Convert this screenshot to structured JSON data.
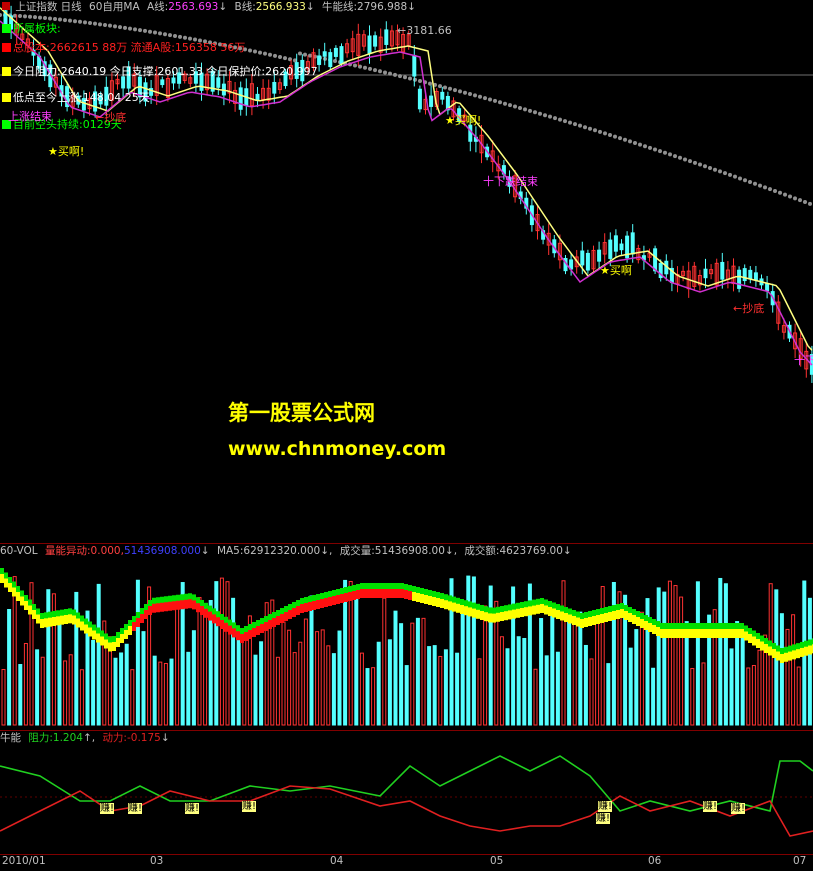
{
  "main": {
    "header": {
      "title": "上证指数 日线",
      "indicator": "60自用MA",
      "a_label": "A线:",
      "a_value": "2563.693",
      "a_arrow": "↓",
      "b_label": "B线:",
      "b_value": "2566.933",
      "b_arrow": "↓",
      "nn_label": "牛能线:",
      "nn_value": "2796.988",
      "nn_arrow": "↓"
    },
    "info_lines": [
      {
        "text": "所属板块:",
        "color": "#00ff00"
      },
      {
        "text": "总股本:2662615 88万  流通A股:156358 56万",
        "color": "#ff0000"
      },
      {
        "text": "今日阻力:2640.19  今日支撑:2601.33  今日保护价:2620.997",
        "color": "#ffffff"
      },
      {
        "text": "低点至今上涨:148.04  25天",
        "color": "#ffffff"
      },
      {
        "text": "目前空头持续:0129天",
        "color": "#00ff00"
      }
    ],
    "annotations": [
      {
        "text": "←3181.66",
        "color": "#c0c0c0"
      },
      {
        "text": "★买啊!",
        "color": "#ffff00"
      },
      {
        "text": "★买啊!",
        "color": "#ffff00"
      },
      {
        "text": "★买啊",
        "color": "#ffff00"
      },
      {
        "text": "←抄底",
        "color": "#ff3030"
      },
      {
        "text": "←抄底",
        "color": "#ff3030"
      },
      {
        "text": "十下跌结束",
        "color": "#ff40ff"
      },
      {
        "text": "上涨结束",
        "color": "#ff40ff"
      },
      {
        "text": "十下跌",
        "color": "#ff40ff"
      }
    ],
    "watermark": {
      "name": "第一股票公式网",
      "url": "www.chnmoney.com"
    }
  },
  "volume": {
    "header": {
      "name": "60-VOL",
      "lbl1": "量能异动:",
      "v1": "0.000,",
      "v2": "51436908.000",
      "v2_arrow": "↓",
      "ma_label": "MA5:",
      "ma_value": "62912320.000",
      "ma_arrow": "↓,",
      "vol_label": "成交量:",
      "vol_value": "51436908.00",
      "vol_arrow": "↓,",
      "amt_label": "成交额:",
      "amt_value": "4623769.00",
      "amt_arrow": "↓"
    }
  },
  "bn": {
    "header": {
      "name": "牛能",
      "res_label": "阻力:",
      "res_value": "1.204",
      "res_arrow": "↑,",
      "pow_label": "动力:",
      "pow_value": "-0.175",
      "pow_arrow": "↓"
    },
    "marks": [
      "赚!",
      "赚!",
      "赚!",
      "赚!",
      "赚!",
      "赚!",
      "赚!",
      "赚!"
    ]
  },
  "dates": [
    "2010/01",
    "03",
    "04",
    "05",
    "06",
    "07"
  ],
  "colors": {
    "up": "#ff3232",
    "down": "#54ffff",
    "ma_yellow": "#ffff80",
    "ma_magenta": "#d030d0",
    "dots": "#909090",
    "res_line": "#20d020",
    "pow_line": "#e02020"
  }
}
